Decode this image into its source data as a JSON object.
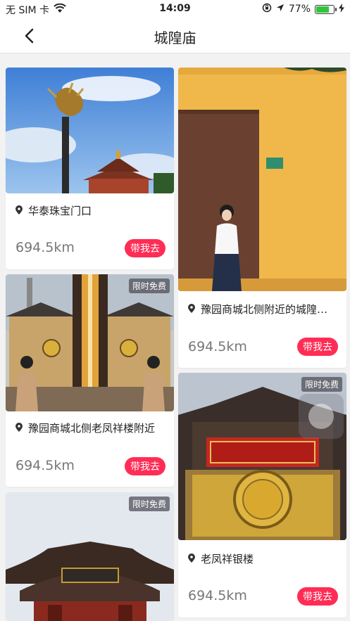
{
  "status": {
    "carrier": "无 SIM 卡",
    "time": "14:09",
    "battery": "77%",
    "battery_level": 0.77
  },
  "nav": {
    "title": "城隍庙"
  },
  "cards": [
    {
      "location": "华泰珠宝门口",
      "distance": "694.5km",
      "go_label": "带我去",
      "badge": ""
    },
    {
      "location": "豫园商城北侧附近的城隍…",
      "distance": "694.5km",
      "go_label": "带我去",
      "badge": ""
    },
    {
      "location": "豫园商城北侧老凤祥楼附近",
      "distance": "694.5km",
      "go_label": "带我去",
      "badge": "限时免费"
    },
    {
      "location": "老凤祥银楼",
      "distance": "694.5km",
      "go_label": "带我去",
      "badge": "限时免费"
    },
    {
      "location": "",
      "distance": "",
      "go_label": "",
      "badge": "限时免费"
    }
  ],
  "colors": {
    "accent": "#ff2d55",
    "battery": "#32c53c"
  }
}
